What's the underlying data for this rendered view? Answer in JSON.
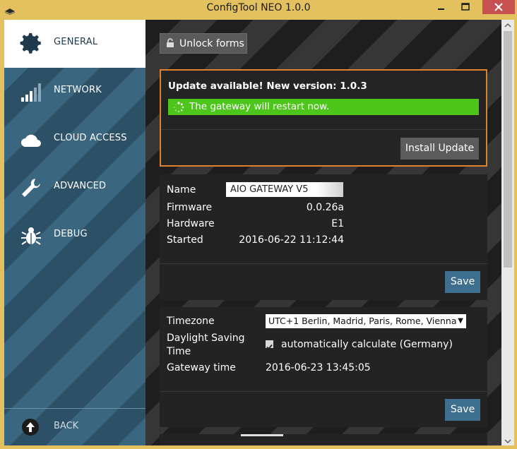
{
  "window": {
    "title": "ConfigTool NEO 1.0.0",
    "accent_color": "#e3c15f",
    "close_color": "#c75050"
  },
  "sidebar": {
    "items": [
      {
        "label": "GENERAL",
        "icon": "gear-icon",
        "active": true
      },
      {
        "label": "NETWORK",
        "icon": "signal-bars-icon",
        "active": false
      },
      {
        "label": "CLOUD ACCESS",
        "icon": "cloud-icon",
        "active": false
      },
      {
        "label": "ADVANCED",
        "icon": "wrench-icon",
        "active": false
      },
      {
        "label": "DEBUG",
        "icon": "bug-icon",
        "active": false
      }
    ],
    "back": {
      "label": "BACK",
      "icon": "back-arrow-icon"
    }
  },
  "toolbar": {
    "unlock_label": "Unlock forms"
  },
  "update": {
    "title": "Update available! New version: 1.0.3",
    "status": "The gateway will restart now.",
    "install_label": "Install Update",
    "border_color": "#e0802a",
    "progress_color": "#4ec51b"
  },
  "info": {
    "name_label": "Name",
    "name_value": "AIO GATEWAY V5",
    "firmware_label": "Firmware",
    "firmware_value": "0.0.26a",
    "hardware_label": "Hardware",
    "hardware_value": "E1",
    "started_label": "Started",
    "started_value": "2016-06-22 11:12:44",
    "save_label": "Save"
  },
  "time": {
    "timezone_label": "Timezone",
    "timezone_value": "UTC+1  Berlin, Madrid, Paris, Rome, Vienna",
    "dst_label_line1": "Daylight Saving",
    "dst_label_line2": "Time",
    "dst_checkbox_label": "automatically calculate (Germany)",
    "dst_checked": true,
    "gateway_time_label": "Gateway time",
    "gateway_time_value": "2016-06-23 13:45:05",
    "save_label": "Save",
    "save_color": "#3f6f8e"
  }
}
